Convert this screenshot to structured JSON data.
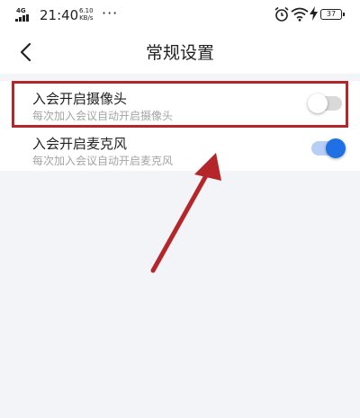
{
  "status_bar": {
    "network": "4G",
    "time": "21:40",
    "speed_value": "6.10",
    "speed_unit": "KB/s",
    "more": "···",
    "battery": "37"
  },
  "nav": {
    "back_icon": "chevron-left-icon",
    "title": "常规设置"
  },
  "settings": [
    {
      "title": "入会开启摄像头",
      "subtitle": "每次加入会议自动开启摄像头",
      "enabled": false
    },
    {
      "title": "入会开启麦克风",
      "subtitle": "每次加入会议自动开启麦克风",
      "enabled": true
    }
  ],
  "annotation": {
    "highlight_color": "#b5262a",
    "arrow_color": "#b5262a"
  },
  "colors": {
    "toggle_on_knob": "#1f6fe5",
    "toggle_on_track": "#b7cff6",
    "toggle_off_track": "#d9d9d9",
    "background": "#f3f4f7"
  }
}
